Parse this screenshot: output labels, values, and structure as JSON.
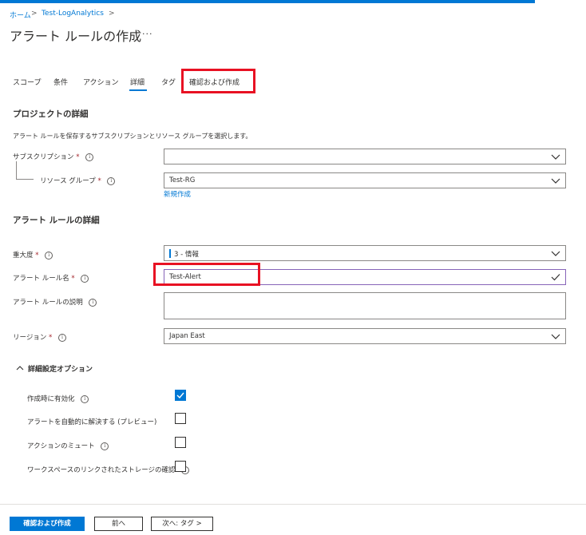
{
  "breadcrumb": {
    "home": "ホーム",
    "workspace": "Test-LogAnalytics",
    "sep": ">"
  },
  "page": {
    "title": "アラート ルールの作成",
    "more": "···"
  },
  "tabs": [
    "スコープ",
    "条件",
    "アクション",
    "詳細",
    "タグ",
    "確認および作成"
  ],
  "active_tab": "詳細",
  "project": {
    "heading": "プロジェクトの詳細",
    "description": "アラート ルールを保存するサブスクリプションとリソース グループを選択します。",
    "subscription_label": "サブスクリプション",
    "subscription_value": "",
    "resource_group_label": "リソース グループ",
    "resource_group_value": "Test-RG",
    "new_link": "新規作成"
  },
  "rule": {
    "heading": "アラート ルールの詳細",
    "severity_label": "重大度",
    "severity_value": "3 - 情報",
    "name_label": "アラート ルール名",
    "name_value": "Test-Alert",
    "description_label": "アラート ルールの説明",
    "description_value": "",
    "region_label": "リージョン",
    "region_value": "Japan East"
  },
  "advanced": {
    "heading": "詳細設定オプション",
    "options": [
      {
        "label": "作成時に有効化",
        "checked": true,
        "info": true
      },
      {
        "label": "アラートを自動的に解決する (プレビュー)",
        "checked": false,
        "info": false
      },
      {
        "label": "アクションのミュート",
        "checked": false,
        "info": true
      },
      {
        "label": "ワークスペースのリンクされたストレージの確認",
        "checked": false,
        "info": true
      }
    ]
  },
  "required_mark": "*",
  "info_glyph": "i",
  "footer": {
    "create": "確認および作成",
    "prev": "前へ",
    "next": "次へ: タグ >"
  },
  "colors": {
    "accent": "#0078d4",
    "highlight": "#e81123",
    "required": "#a4262c"
  }
}
